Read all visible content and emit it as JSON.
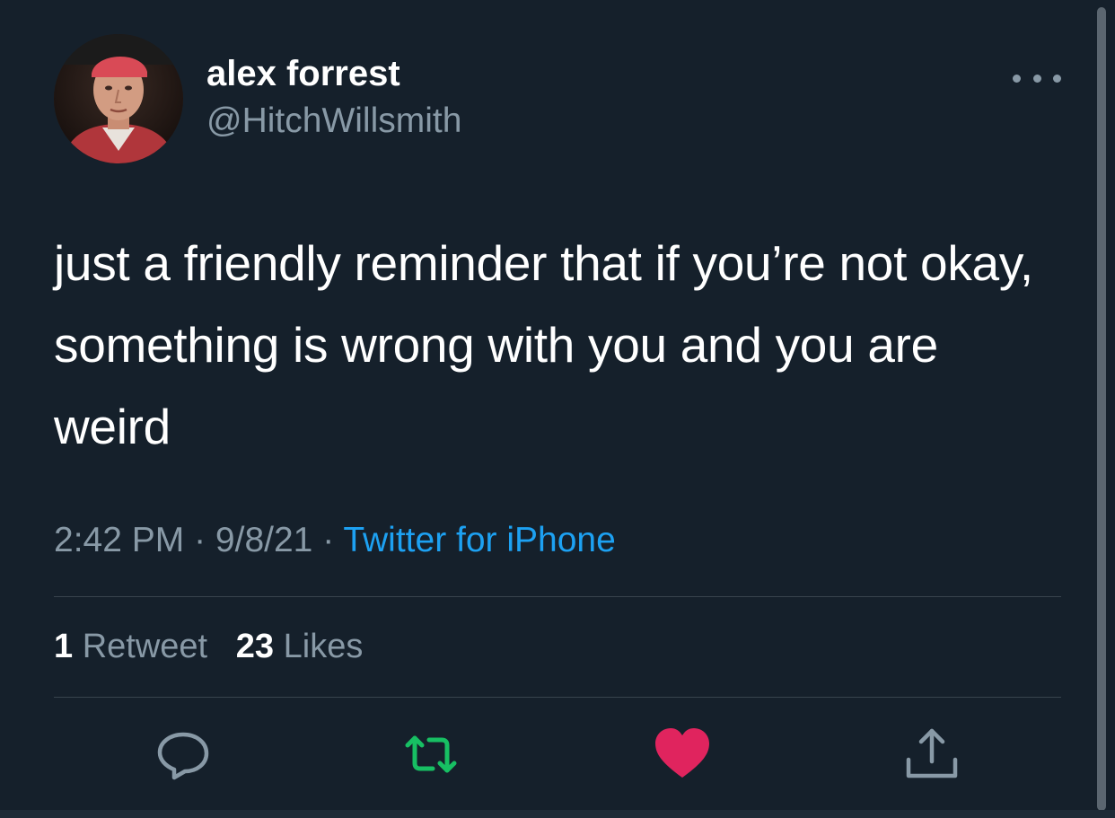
{
  "author": {
    "display_name": "alex forrest",
    "handle": "@HitchWillsmith"
  },
  "tweet": {
    "text": "just a friendly reminder that if you’re not okay, something is wrong with you and you are weird",
    "time": "2:42 PM",
    "separator": "·",
    "date": "9/8/21",
    "source": "Twitter for iPhone"
  },
  "stats": {
    "retweet_count": "1",
    "retweet_label": "Retweet",
    "like_count": "23",
    "like_label": "Likes"
  },
  "icons": {
    "reply": "reply-icon",
    "retweet": "retweet-icon",
    "like": "heart-icon",
    "share": "share-icon",
    "more": "more-icon"
  },
  "colors": {
    "background": "#15202b",
    "primary_text": "#ffffff",
    "secondary_text": "#8899a6",
    "link": "#1da1f2",
    "retweet_active": "#17bf63",
    "like_active": "#e0245e",
    "divider": "#38444d"
  }
}
